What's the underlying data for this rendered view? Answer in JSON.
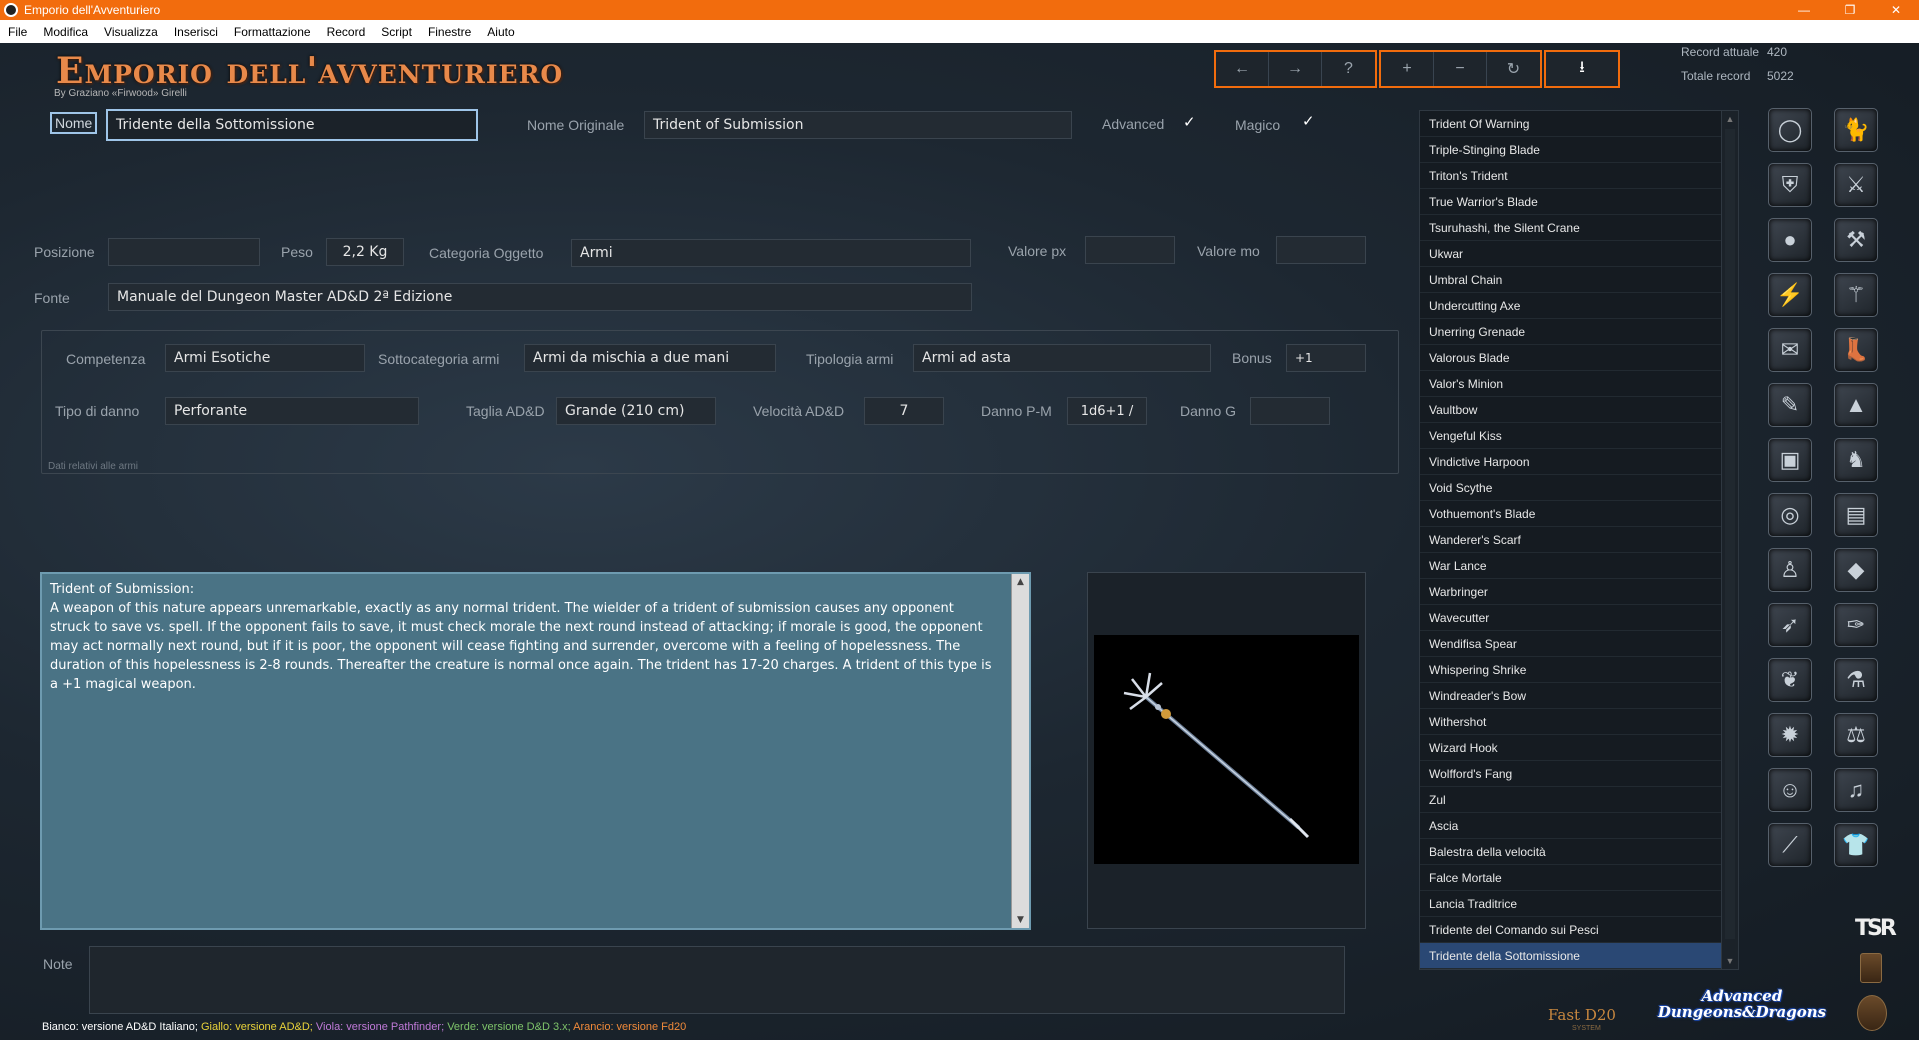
{
  "window": {
    "title": "Emporio dell'Avventuriero",
    "controls": [
      "—",
      "❐",
      "✕"
    ]
  },
  "menu": [
    "File",
    "Modifica",
    "Visualizza",
    "Inserisci",
    "Formattazione",
    "Record",
    "Script",
    "Finestre",
    "Aiuto"
  ],
  "header": {
    "logo": "Emporio dell'avventuriero",
    "byline": "By Graziano «Firwood» Girelli"
  },
  "toolbar": {
    "icons": [
      "←",
      "→",
      "?",
      "+",
      "−",
      "↻",
      "⭳"
    ],
    "icon_names": [
      "prev-record-icon",
      "next-record-icon",
      "help-icon",
      "add-record-icon",
      "delete-record-icon",
      "refresh-icon",
      "export-icon"
    ]
  },
  "records": {
    "current_label": "Record attuale",
    "current_value": "420",
    "total_label": "Totale record",
    "total_value": "5022"
  },
  "form": {
    "nome_label": "Nome",
    "nome_value": "Tridente della Sottomissione",
    "nome_originale_label": "Nome Originale",
    "nome_originale_value": "Trident of Submission",
    "advanced_label": "Advanced",
    "magico_label": "Magico",
    "check_mark": "✓",
    "posizione_label": "Posizione",
    "posizione_value": "",
    "peso_label": "Peso",
    "peso_value": "2,2 Kg",
    "categoria_label": "Categoria Oggetto",
    "categoria_value": "Armi",
    "valore_px_label": "Valore px",
    "valore_px_value": "",
    "valore_mo_label": "Valore mo",
    "valore_mo_value": "",
    "fonte_label": "Fonte",
    "fonte_value": "Manuale del Dungeon Master AD&D 2ª Edizione"
  },
  "weapons": {
    "competenza_label": "Competenza",
    "competenza_value": "Armi Esotiche",
    "sottocategoria_label": "Sottocategoria armi",
    "sottocategoria_value": "Armi da mischia a due mani",
    "tipologia_label": "Tipologia armi",
    "tipologia_value": "Armi ad asta",
    "bonus_label": "Bonus",
    "bonus_value": "+1",
    "tipo_danno_label": "Tipo di danno",
    "tipo_danno_value": "Perforante",
    "taglia_label": "Taglia AD&D",
    "taglia_value": "Grande (210 cm)",
    "velocita_label": "Velocità AD&D",
    "velocita_value": "7",
    "danno_pm_label": "Danno P-M",
    "danno_pm_value": "1d6+1 /",
    "danno_g_label": "Danno G",
    "danno_g_value": "",
    "caption": "Dati relativi alle armi"
  },
  "description": {
    "title": "Trident of Submission:",
    "body": "A weapon of this nature appears unremarkable, exactly as any normal trident. The wielder of a trident of submission causes any opponent struck to save vs. spell. If the opponent fails to save, it must check morale the next round instead of attacking; if morale is good, the opponent may act normally next round, but if it is poor, the opponent will cease fighting and surrender, overcome with a feeling of hopelessness. The duration of this hopelessness is 2-8 rounds. Thereafter the creature is normal once again. The trident has 17-20 charges. A trident of this type is a +1 magical weapon."
  },
  "note": {
    "label": "Note",
    "value": ""
  },
  "legend": [
    {
      "text": "Bianco: versione AD&D Italiano; ",
      "color": "#ffffff"
    },
    {
      "text": "Giallo: versione AD&D; ",
      "color": "#e8d23a"
    },
    {
      "text": "Viola: versione Pathfinder; ",
      "color": "#c07ad8"
    },
    {
      "text": "Verde: versione D&D 3.x; ",
      "color": "#7ec46a"
    },
    {
      "text": "Arancio: versione Fd20",
      "color": "#f08a3a"
    }
  ],
  "list": {
    "items": [
      "Trident Of Warning",
      "Triple-Stinging Blade",
      "Triton's Trident",
      "True Warrior's Blade",
      "Tsuruhashi, the Silent Crane",
      "Ukwar",
      "Umbral Chain",
      "Undercutting Axe",
      "Unerring Grenade",
      "Valorous Blade",
      "Valor's Minion",
      "Vaultbow",
      "Vengeful Kiss",
      "Vindictive Harpoon",
      "Void Scythe",
      "Vothuemont's Blade",
      "Wanderer's Scarf",
      "War Lance",
      "Warbringer",
      "Wavecutter",
      "Wendifisa Spear",
      "Whispering Shrike",
      "Windreader's Bow",
      "Withershot",
      "Wizard Hook",
      "Wolfford's Fang",
      "Zul",
      "Ascia",
      "Balestra della velocità",
      "Falce Mortale",
      "Lancia Traditrice",
      "Tridente del Comando sui Pesci",
      "Tridente della Sottomissione"
    ],
    "selected_index": 32
  },
  "categories": {
    "left": [
      "ring-icon",
      "armor-icon",
      "orb-icon",
      "wand-icon",
      "backpack-icon",
      "dye-icon",
      "chest-icon",
      "amulet-icon",
      "robe-icon",
      "quiver-icon",
      "scroll-icon",
      "fire-icon",
      "doll-icon",
      "staff-icon"
    ],
    "right": [
      "cat-icon",
      "weapon-icon",
      "tools-icon",
      "rod-icon",
      "boots-icon",
      "hat-icon",
      "horse-icon",
      "book-icon",
      "gem-icon",
      "feather-icon",
      "potion-icon",
      "scales-icon",
      "instrument-icon",
      "clothing-icon"
    ],
    "left_glyphs": [
      "◯",
      "⛨",
      "●",
      "⚡",
      "✉",
      "✎",
      "▣",
      "◎",
      "♙",
      "➶",
      "❦",
      "✹",
      "☺",
      "⟋"
    ],
    "right_glyphs": [
      "🐈",
      "⚔",
      "⚒",
      "⚚",
      "👢",
      "▲",
      "♞",
      "▤",
      "◆",
      "✑",
      "⚗",
      "⚖",
      "♫",
      "👕"
    ]
  },
  "brands": {
    "fast_d20": "Fast D20",
    "fast_d20_sub": "SYSTEM",
    "add": "Advanced Dungeons&Dragons",
    "tsr": "TSR"
  }
}
